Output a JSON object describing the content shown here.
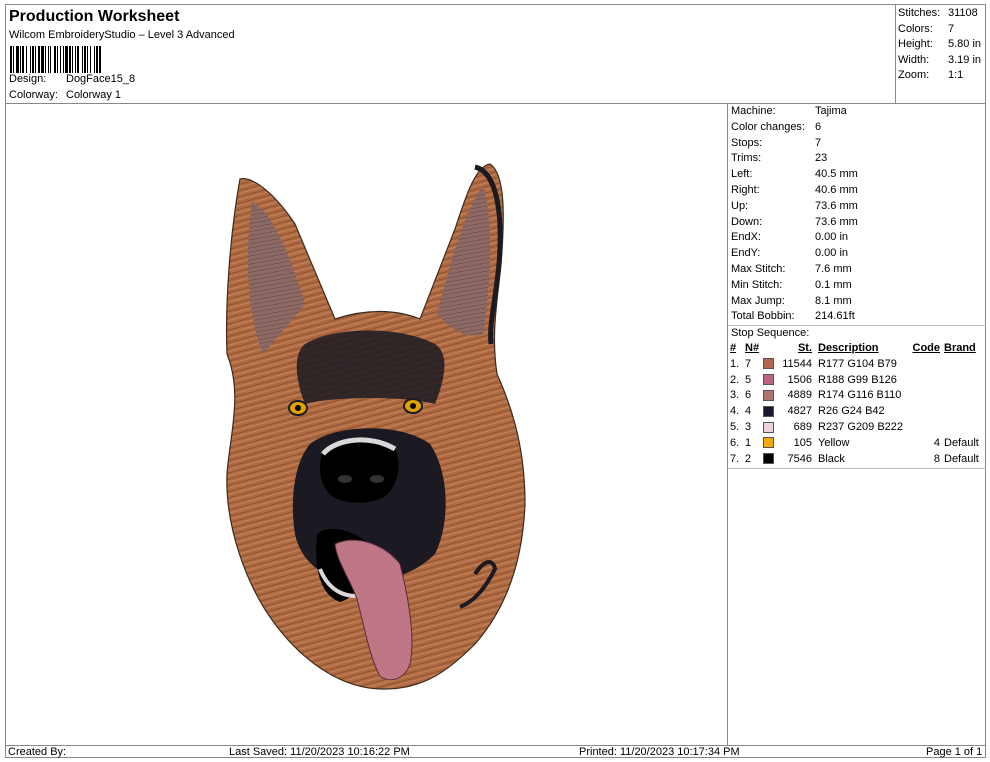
{
  "header": {
    "title": "Production Worksheet",
    "subtitle": "Wilcom EmbroideryStudio – Level 3 Advanced",
    "design_label": "Design:",
    "design_value": "DogFace15_8",
    "colorway_label": "Colorway:",
    "colorway_value": "Colorway 1"
  },
  "summary": [
    {
      "label": "Stitches:",
      "value": "31108"
    },
    {
      "label": "Colors:",
      "value": "7"
    },
    {
      "label": "Height:",
      "value": "5.80 in"
    },
    {
      "label": "Width:",
      "value": "3.19 in"
    },
    {
      "label": "Zoom:",
      "value": "1:1"
    }
  ],
  "machine_info": [
    {
      "label": "Machine:",
      "value": "Tajima"
    },
    {
      "label": "Color changes:",
      "value": "6"
    },
    {
      "label": "Stops:",
      "value": "7"
    },
    {
      "label": "Trims:",
      "value": "23"
    },
    {
      "label": "Left:",
      "value": "40.5 mm"
    },
    {
      "label": "Right:",
      "value": "40.6 mm"
    },
    {
      "label": "Up:",
      "value": "73.6 mm"
    },
    {
      "label": "Down:",
      "value": "73.6 mm"
    },
    {
      "label": "EndX:",
      "value": "0.00 in"
    },
    {
      "label": "EndY:",
      "value": "0.00 in"
    },
    {
      "label": "Max Stitch:",
      "value": "7.6 mm"
    },
    {
      "label": "Min Stitch:",
      "value": "0.1 mm"
    },
    {
      "label": "Max Jump:",
      "value": "8.1 mm"
    },
    {
      "label": "Total Bobbin:",
      "value": "214.61ft"
    }
  ],
  "stop_sequence": {
    "title": "Stop Sequence:",
    "columns": {
      "num": "#",
      "n": "N#",
      "st": "St.",
      "desc": "Description",
      "code": "Code",
      "brand": "Brand"
    },
    "rows": [
      {
        "num": "1.",
        "n": "7",
        "color": "#B1684F",
        "st": "11544",
        "desc": "R177 G104 B79",
        "code": "",
        "brand": ""
      },
      {
        "num": "2.",
        "n": "5",
        "color": "#BC637E",
        "st": "1506",
        "desc": "R188 G99 B126",
        "code": "",
        "brand": ""
      },
      {
        "num": "3.",
        "n": "6",
        "color": "#AE746E",
        "st": "4889",
        "desc": "R174 G116 B110",
        "code": "",
        "brand": ""
      },
      {
        "num": "4.",
        "n": "4",
        "color": "#1A182A",
        "st": "4827",
        "desc": "R26 G24 B42",
        "code": "",
        "brand": ""
      },
      {
        "num": "5.",
        "n": "3",
        "color": "#EDD1DE",
        "st": "689",
        "desc": "R237 G209 B222",
        "code": "",
        "brand": ""
      },
      {
        "num": "6.",
        "n": "1",
        "color": "#F7A800",
        "st": "105",
        "desc": "Yellow",
        "code": "4",
        "brand": "Default"
      },
      {
        "num": "7.",
        "n": "2",
        "color": "#000000",
        "st": "7546",
        "desc": "Black",
        "code": "8",
        "brand": "Default"
      }
    ]
  },
  "footer": {
    "created_by": "Created By:",
    "last_saved": "Last Saved: 11/20/2023 10:16:22 PM",
    "printed": "Printed: 11/20/2023 10:17:34 PM",
    "page": "Page 1 of 1"
  },
  "design_colors": {
    "fur": "#B06A42",
    "fur_dark": "#6E3E22",
    "mask": "#1B1A22",
    "ear_inner": "#8E6A66",
    "tongue": "#C27A8A",
    "eye": "#E2A200",
    "highlight": "#DCD8DA"
  }
}
